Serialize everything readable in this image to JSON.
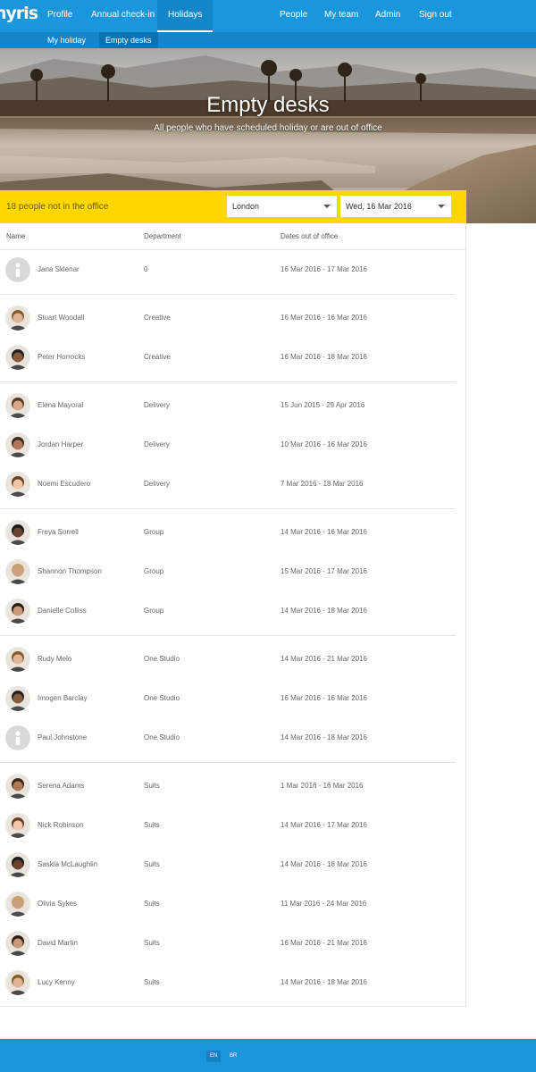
{
  "app": {
    "logo": "nyris"
  },
  "nav": {
    "left": [
      {
        "label": "Profile",
        "active": false
      },
      {
        "label": "Annual check-in",
        "active": false
      },
      {
        "label": "Holidays",
        "active": true
      }
    ],
    "right": [
      {
        "label": "People"
      },
      {
        "label": "My team"
      },
      {
        "label": "Admin"
      },
      {
        "label": "Sign out"
      }
    ]
  },
  "subnav": [
    {
      "label": "My holiday",
      "active": false
    },
    {
      "label": "Empty desks",
      "active": true
    }
  ],
  "hero": {
    "title": "Empty desks",
    "subtitle": "All people who have scheduled holiday or are out of office"
  },
  "filter": {
    "count_text": "18 people not in the office",
    "location": "London",
    "date": "Wed, 16 Mar 2016"
  },
  "table": {
    "headers": [
      "Name",
      "Department",
      "Dates out of office"
    ],
    "rows": [
      {
        "name": "Jana Sklenar",
        "department": "0",
        "dates": "16 Mar 2016 - 17 Mar 2016",
        "avatar": "placeholder"
      },
      {
        "name": "Stuart Woodall",
        "department": "Creative",
        "dates": "16 Mar 2016 - 16 Mar 2016",
        "avatar": "photo"
      },
      {
        "name": "Peter Horrocks",
        "department": "Creative",
        "dates": "16 Mar 2016 - 18 Mar 2016",
        "avatar": "photo"
      },
      {
        "name": "Elena Mayoral",
        "department": "Delivery",
        "dates": "15 Jun 2015 - 29 Apr 2016",
        "avatar": "photo"
      },
      {
        "name": "Jordan Harper",
        "department": "Delivery",
        "dates": "10 Mar 2016 - 16 Mar 2016",
        "avatar": "photo"
      },
      {
        "name": "Noemi Escudero",
        "department": "Delivery",
        "dates": "7 Mar 2016 - 18 Mar 2016",
        "avatar": "photo"
      },
      {
        "name": "Freya Sorrell",
        "department": "Group",
        "dates": "14 Mar 2016 - 16 Mar 2016",
        "avatar": "photo"
      },
      {
        "name": "Shannon Thompson",
        "department": "Group",
        "dates": "15 Mar 2016 - 17 Mar 2016",
        "avatar": "photo"
      },
      {
        "name": "Danielle Colliss",
        "department": "Group",
        "dates": "14 Mar 2016 - 18 Mar 2016",
        "avatar": "photo"
      },
      {
        "name": "Rudy Melo",
        "department": "One Studio",
        "dates": "14 Mar 2016 - 21 Mar 2016",
        "avatar": "photo"
      },
      {
        "name": "Imogen Barclay",
        "department": "One Studio",
        "dates": "16 Mar 2016 - 16 Mar 2016",
        "avatar": "photo"
      },
      {
        "name": "Paul Johnstone",
        "department": "One Studio",
        "dates": "14 Mar 2016 - 18 Mar 2016",
        "avatar": "placeholder"
      },
      {
        "name": "Serena Adams",
        "department": "Suits",
        "dates": "1 Mar 2016 - 16 Mar 2016",
        "avatar": "photo"
      },
      {
        "name": "Nick Robinson",
        "department": "Suits",
        "dates": "14 Mar 2016 - 17 Mar 2016",
        "avatar": "photo"
      },
      {
        "name": "Saskia McLaughlin",
        "department": "Suits",
        "dates": "14 Mar 2016 - 18 Mar 2016",
        "avatar": "photo"
      },
      {
        "name": "Olivia Sykes",
        "department": "Suits",
        "dates": "11 Mar 2016 - 24 Mar 2016",
        "avatar": "photo"
      },
      {
        "name": "David Martin",
        "department": "Suits",
        "dates": "16 Mar 2016 - 21 Mar 2016",
        "avatar": "photo"
      },
      {
        "name": "Lucy Kenny",
        "department": "Suits",
        "dates": "14 Mar 2016 - 18 Mar 2016",
        "avatar": "photo"
      }
    ]
  },
  "footer": {
    "languages": [
      {
        "label": "EN",
        "active": true
      },
      {
        "label": "BR",
        "active": false
      }
    ]
  },
  "colors": {
    "primary": "#1a96dc",
    "subnav": "#1385c8",
    "highlight": "#ffd700"
  }
}
